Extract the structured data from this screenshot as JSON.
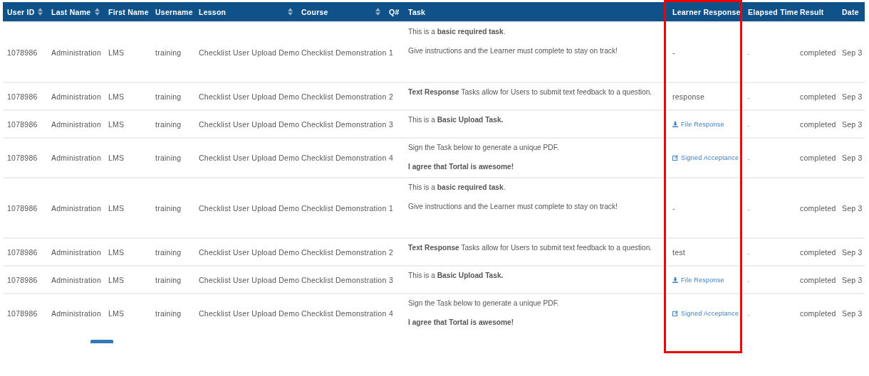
{
  "table": {
    "columns": [
      {
        "label": "User ID",
        "sortable": true,
        "highlighted": false
      },
      {
        "label": "Last Name",
        "sortable": true,
        "highlighted": false
      },
      {
        "label": "First Name",
        "sortable": false,
        "highlighted": false
      },
      {
        "label": "Username",
        "sortable": false,
        "highlighted": false
      },
      {
        "label": "Lesson",
        "sortable": true,
        "highlighted": false
      },
      {
        "label": "Course",
        "sortable": true,
        "highlighted": false
      },
      {
        "label": "Q#",
        "sortable": false,
        "highlighted": false
      },
      {
        "label": "Task",
        "sortable": false,
        "highlighted": false
      },
      {
        "label": "Learner Response",
        "sortable": false,
        "highlighted": true
      },
      {
        "label": "Elapsed Time",
        "sortable": false,
        "highlighted": false
      },
      {
        "label": "Result",
        "sortable": false,
        "highlighted": false
      },
      {
        "label": "Date",
        "sortable": false,
        "highlighted": false
      }
    ],
    "rows": [
      {
        "user_id": "1078986",
        "last_name": "Administration",
        "first_name": "LMS",
        "username": "training",
        "lesson": "Checklist User Upload Demo",
        "course": "Checklist Demonstration",
        "q": "1",
        "task": [
          "This is a **basic required task**.",
          "Give instructions and the Learner must complete to stay on track!"
        ],
        "response": {
          "kind": "text",
          "text": "-"
        },
        "elapsed": "-",
        "result": "completed",
        "date": "Sep 3"
      },
      {
        "user_id": "1078986",
        "last_name": "Administration",
        "first_name": "LMS",
        "username": "training",
        "lesson": "Checklist User Upload Demo",
        "course": "Checklist Demonstration",
        "q": "2",
        "task": [
          "**Text Response** Tasks allow for Users to submit text feedback to a question."
        ],
        "response": {
          "kind": "text",
          "text": "response"
        },
        "elapsed": "-",
        "result": "completed",
        "date": "Sep 3"
      },
      {
        "user_id": "1078986",
        "last_name": "Administration",
        "first_name": "LMS",
        "username": "training",
        "lesson": "Checklist User Upload Demo",
        "course": "Checklist Demonstration",
        "q": "3",
        "task": [
          "This is a **Basic Upload Task.**"
        ],
        "response": {
          "kind": "file",
          "text": "File Response"
        },
        "elapsed": "-",
        "result": "completed",
        "date": "Sep 3"
      },
      {
        "user_id": "1078986",
        "last_name": "Administration",
        "first_name": "LMS",
        "username": "training",
        "lesson": "Checklist User Upload Demo",
        "course": "Checklist Demonstration",
        "q": "4",
        "task": [
          "Sign the Task below to generate a unique PDF.",
          "**I agree that Tortal is awesome!**"
        ],
        "response": {
          "kind": "signed",
          "text": "Signed Acceptance"
        },
        "elapsed": "-",
        "result": "completed",
        "date": "Sep 3"
      },
      {
        "user_id": "1078986",
        "last_name": "Administration",
        "first_name": "LMS",
        "username": "training",
        "lesson": "Checklist User Upload Demo",
        "course": "Checklist Demonstration",
        "q": "1",
        "task": [
          "This is a **basic required task**.",
          "Give instructions and the Learner must complete to stay on track!"
        ],
        "response": {
          "kind": "text",
          "text": "-"
        },
        "elapsed": "-",
        "result": "completed",
        "date": "Sep 3"
      },
      {
        "user_id": "1078986",
        "last_name": "Administration",
        "first_name": "LMS",
        "username": "training",
        "lesson": "Checklist User Upload Demo",
        "course": "Checklist Demonstration",
        "q": "2",
        "task": [
          "**Text Response** Tasks allow for Users to submit text feedback to a question."
        ],
        "response": {
          "kind": "text",
          "text": "test"
        },
        "elapsed": "-",
        "result": "completed",
        "date": "Sep 3"
      },
      {
        "user_id": "1078986",
        "last_name": "Administration",
        "first_name": "LMS",
        "username": "training",
        "lesson": "Checklist User Upload Demo",
        "course": "Checklist Demonstration",
        "q": "3",
        "task": [
          "This is a **Basic Upload Task.**"
        ],
        "response": {
          "kind": "file",
          "text": "File Response"
        },
        "elapsed": "-",
        "result": "completed",
        "date": "Sep 3"
      },
      {
        "user_id": "1078986",
        "last_name": "Administration",
        "first_name": "LMS",
        "username": "training",
        "lesson": "Checklist User Upload Demo",
        "course": "Checklist Demonstration",
        "q": "4",
        "task": [
          "Sign the Task below to generate a unique PDF.",
          "**I agree that Tortal is awesome!**"
        ],
        "response": {
          "kind": "signed",
          "text": "Signed Acceptance"
        },
        "elapsed": "-",
        "result": "completed",
        "date": "Sep 3"
      }
    ]
  }
}
